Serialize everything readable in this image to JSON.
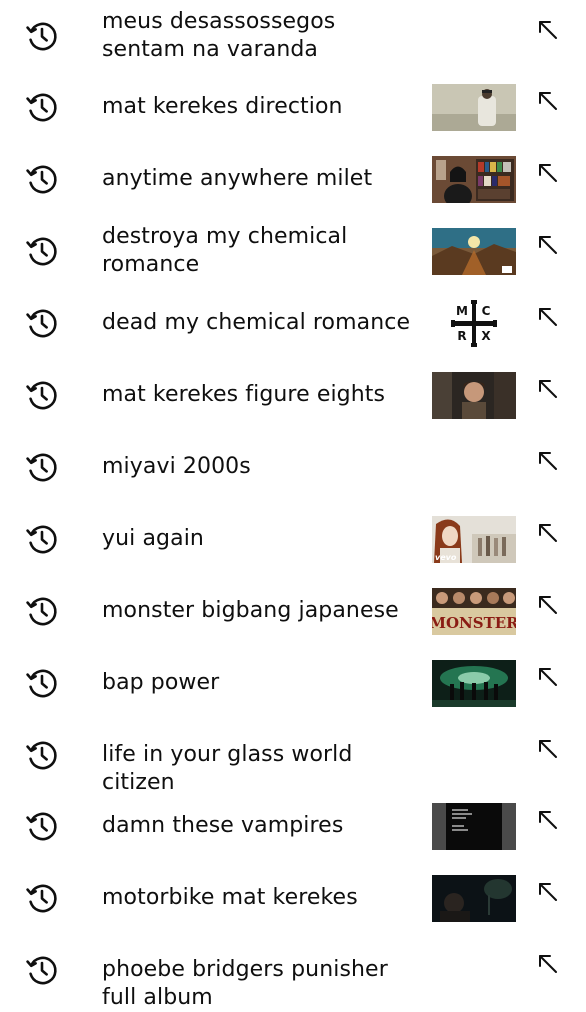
{
  "suggestions": [
    {
      "text": "meus desassossegos sentam na varanda",
      "thumbnail": "none"
    },
    {
      "text": "mat kerekes direction",
      "thumbnail": "man-standing-light-background"
    },
    {
      "text": "anytime anywhere milet",
      "thumbnail": "person-with-bookshelf"
    },
    {
      "text": "destroya my chemical romance",
      "thumbnail": "desert-album-art"
    },
    {
      "text": "dead my chemical romance",
      "thumbnail": "mcrx-cross-logo",
      "logo_letters": [
        "M",
        "C",
        "R",
        "X"
      ]
    },
    {
      "text": "mat kerekes figure eights",
      "thumbnail": "dark-portrait"
    },
    {
      "text": "miyavi 2000s",
      "thumbnail": "none"
    },
    {
      "text": "yui again",
      "thumbnail": "singer-vevo",
      "badge": "vevo"
    },
    {
      "text": "monster bigbang japanese",
      "thumbnail": "monster-group-poster",
      "poster_title": "MONSTER"
    },
    {
      "text": "bap power",
      "thumbnail": "green-stage-group"
    },
    {
      "text": "life in your glass world citizen",
      "thumbnail": "none"
    },
    {
      "text": "damn these vampires",
      "thumbnail": "dark-text-cover"
    },
    {
      "text": "motorbike mat kerekes",
      "thumbnail": "dark-night-scene"
    },
    {
      "text": "phoebe bridgers punisher full album",
      "thumbnail": "none"
    }
  ],
  "icons": {
    "leading": "history-icon",
    "trailing": "arrow-up-left-icon"
  },
  "colors": {
    "background": "#ffffff",
    "text": "#0f0f0f",
    "icon": "#0f0f0f"
  }
}
